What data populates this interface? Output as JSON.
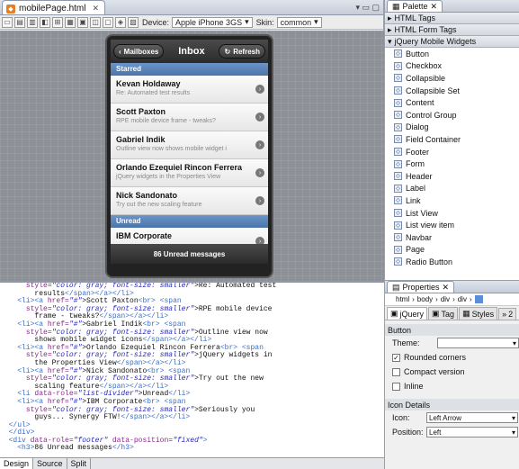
{
  "editor": {
    "tab_title": "mobilePage.html",
    "tab_close": "✕",
    "tab_ctrl": "▾ ▭ ▢",
    "toolbar": {
      "device_label": "Device:",
      "device_value": "Apple iPhone 3GS",
      "skin_label": "Skin:",
      "skin_value": "common"
    },
    "bottom_tabs": [
      "Design",
      "Source",
      "Split"
    ]
  },
  "phone": {
    "back_label": "Mailboxes",
    "title": "Inbox",
    "refresh_label": "Refresh",
    "dividers": [
      "Starred",
      "Unread"
    ],
    "starred": [
      {
        "name": "Kevan Holdaway",
        "snippet": "Re: Automated test results"
      },
      {
        "name": "Scott Paxton",
        "snippet": "RPE mobile device frame - tweaks?"
      },
      {
        "name": "Gabriel Indik",
        "snippet": "Outline view now shows mobile widget i"
      },
      {
        "name": "Orlando Ezequiel Rincon Ferrera",
        "snippet": "jQuery widgets in the Properties View"
      },
      {
        "name": "Nick Sandonato",
        "snippet": "Try out the new scaling feature"
      }
    ],
    "unread": [
      {
        "name": "IBM Corporate",
        "snippet": ""
      }
    ],
    "footer": "86 Unread messages"
  },
  "palette": {
    "title": "Palette",
    "categories": [
      "HTML Tags",
      "HTML Form Tags",
      "jQuery Mobile Widgets"
    ],
    "items": [
      "Button",
      "Checkbox",
      "Collapsible",
      "Collapsible Set",
      "Content",
      "Control Group",
      "Dialog",
      "Field Container",
      "Footer",
      "Form",
      "Header",
      "Label",
      "Link",
      "List View",
      "List view item",
      "Navbar",
      "Page",
      "Radio Button"
    ]
  },
  "properties": {
    "title": "Properties",
    "breadcrumb": [
      "html",
      "body",
      "div",
      "div"
    ],
    "tabs": [
      "jQuery",
      "Tag",
      "Styles",
      "2"
    ],
    "section_button": "Button",
    "theme_label": "Theme:",
    "theme_value": "",
    "rounded_label": "Rounded corners",
    "compact_label": "Compact version",
    "inline_label": "Inline",
    "section_icon": "Icon Details",
    "icon_label": "Icon:",
    "icon_value": "Left Arrow",
    "position_label": "Position:",
    "position_value": "Left"
  },
  "source_lines": [
    [
      [
        "      ",
        "t"
      ],
      [
        "style=",
        "a"
      ],
      [
        "\"color: gray; font-size: smaller\"",
        "v"
      ],
      [
        ">Re: Automated test",
        "x"
      ]
    ],
    [
      [
        "        results",
        "x"
      ],
      [
        "</span></a></li>",
        "g"
      ]
    ],
    [
      [
        "    ",
        "t"
      ],
      [
        "<li><a ",
        "g"
      ],
      [
        "href=",
        "a"
      ],
      [
        "\"#\"",
        "v"
      ],
      [
        ">Scott Paxton",
        "x"
      ],
      [
        "<br>",
        "g"
      ],
      [
        " <span",
        "g"
      ]
    ],
    [
      [
        "      ",
        "t"
      ],
      [
        "style=",
        "a"
      ],
      [
        "\"color: gray; font-size: smaller\"",
        "v"
      ],
      [
        ">RPE mobile device",
        "x"
      ]
    ],
    [
      [
        "        frame - tweaks?",
        "x"
      ],
      [
        "</span></a></li>",
        "g"
      ]
    ],
    [
      [
        "    ",
        "t"
      ],
      [
        "<li><a ",
        "g"
      ],
      [
        "href=",
        "a"
      ],
      [
        "\"#\"",
        "v"
      ],
      [
        ">Gabriel Indik",
        "x"
      ],
      [
        "<br>",
        "g"
      ],
      [
        " <span",
        "g"
      ]
    ],
    [
      [
        "      ",
        "t"
      ],
      [
        "style=",
        "a"
      ],
      [
        "\"color: gray; font-size: smaller\"",
        "v"
      ],
      [
        ">Outline view now",
        "x"
      ]
    ],
    [
      [
        "        shows mobile widget icons",
        "x"
      ],
      [
        "</span></a></li>",
        "g"
      ]
    ],
    [
      [
        "    ",
        "t"
      ],
      [
        "<li><a ",
        "g"
      ],
      [
        "href=",
        "a"
      ],
      [
        "\"#\"",
        "v"
      ],
      [
        ">Orlando Ezequiel Rincon Ferrera",
        "x"
      ],
      [
        "<br>",
        "g"
      ],
      [
        " <span",
        "g"
      ]
    ],
    [
      [
        "      ",
        "t"
      ],
      [
        "style=",
        "a"
      ],
      [
        "\"color: gray; font-size: smaller\"",
        "v"
      ],
      [
        ">jQuery widgets in",
        "x"
      ]
    ],
    [
      [
        "        the Properties View",
        "x"
      ],
      [
        "</span></a></li>",
        "g"
      ]
    ],
    [
      [
        "    ",
        "t"
      ],
      [
        "<li><a ",
        "g"
      ],
      [
        "href=",
        "a"
      ],
      [
        "\"#\"",
        "v"
      ],
      [
        ">Nick Sandonato",
        "x"
      ],
      [
        "<br>",
        "g"
      ],
      [
        " <span",
        "g"
      ]
    ],
    [
      [
        "      ",
        "t"
      ],
      [
        "style=",
        "a"
      ],
      [
        "\"color: gray; font-size: smaller\"",
        "v"
      ],
      [
        ">Try out the new",
        "x"
      ]
    ],
    [
      [
        "        scaling feature",
        "x"
      ],
      [
        "</span></a></li>",
        "g"
      ]
    ],
    [
      [
        "    ",
        "t"
      ],
      [
        "<li ",
        "g"
      ],
      [
        "data-role=",
        "a"
      ],
      [
        "\"list-divider\"",
        "v"
      ],
      [
        ">Unread",
        "x"
      ],
      [
        "</li>",
        "g"
      ]
    ],
    [
      [
        "    ",
        "t"
      ],
      [
        "<li><a ",
        "g"
      ],
      [
        "href=",
        "a"
      ],
      [
        "\"#\"",
        "v"
      ],
      [
        ">IBM Corporate",
        "x"
      ],
      [
        "<br>",
        "g"
      ],
      [
        " <span",
        "g"
      ]
    ],
    [
      [
        "      ",
        "t"
      ],
      [
        "style=",
        "a"
      ],
      [
        "\"color: gray; font-size: smaller\"",
        "v"
      ],
      [
        ">Seriously you",
        "x"
      ]
    ],
    [
      [
        "        guys... Synergy FTW!",
        "x"
      ],
      [
        "</span></a></li>",
        "g"
      ]
    ],
    [
      [
        "  ",
        "t"
      ],
      [
        "</ul>",
        "g"
      ]
    ],
    [
      [
        "  ",
        "t"
      ],
      [
        "</div>",
        "g"
      ]
    ],
    [
      [
        "  ",
        "t"
      ],
      [
        "<div ",
        "g"
      ],
      [
        "data-role=",
        "a"
      ],
      [
        "\"footer\"",
        "v"
      ],
      [
        " data-position=",
        "a"
      ],
      [
        "\"fixed\"",
        "v"
      ],
      [
        ">",
        "g"
      ]
    ],
    [
      [
        "    ",
        "t"
      ],
      [
        "<h3>",
        "g"
      ],
      [
        "86 Unread messages",
        "x"
      ],
      [
        "</h3>",
        "g"
      ]
    ]
  ]
}
